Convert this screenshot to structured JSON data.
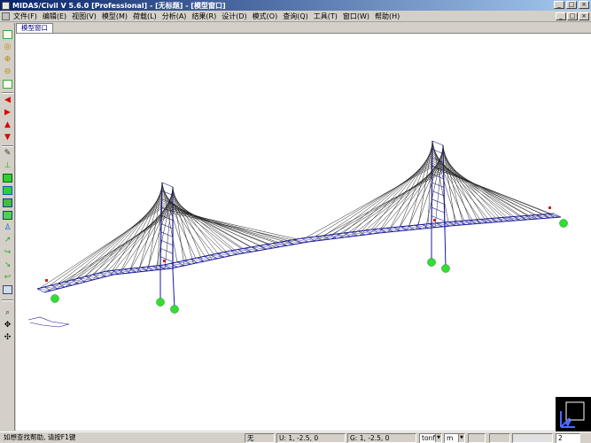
{
  "window": {
    "title": "MIDAS/Civil V 5.6.0 [Professional] - [无标题] - [模型窗口]",
    "min_glyph": "_",
    "max_glyph": "□",
    "close_glyph": "×"
  },
  "menu": {
    "items": [
      "文件(F)",
      "编辑(E)",
      "视图(V)",
      "模型(M)",
      "荷载(L)",
      "分析(A)",
      "结果(R)",
      "设计(D)",
      "模式(O)",
      "查询(Q)",
      "工具(T)",
      "窗口(W)",
      "帮助(H)"
    ]
  },
  "tabs": {
    "active": "模型窗口"
  },
  "toolbar": {
    "icons": [
      "zoom-fit-icon",
      "zoom-window-icon",
      "zoom-in-icon",
      "zoom-out-icon",
      "auto-fit-icon",
      "pan-left-icon",
      "pan-right-icon",
      "pan-up-icon",
      "pan-down-icon",
      "display-icon",
      "node-icon",
      "element-icon",
      "shrink-icon",
      "copy-icon",
      "boundary-icon",
      "rotate-icon",
      "hidden-icon",
      "perspective-icon",
      "render-icon",
      "view-icon",
      "select-icon",
      "move-icon",
      "grip-icon"
    ]
  },
  "status": {
    "help": "如想查找帮助, 请按F1键",
    "none": "无",
    "u_coord": "U: 1, -2.5, 0",
    "g_coord": "G: 1, -2.5, 0",
    "force_unit": "tonf",
    "length_unit": "m",
    "page_value": "2"
  },
  "colors": {
    "titlebar_start": "#0a246a",
    "model_line": "#1a1aa0",
    "support_node": "#33dd33",
    "load_marker": "#cc2222",
    "canvas": "#ffffff"
  }
}
